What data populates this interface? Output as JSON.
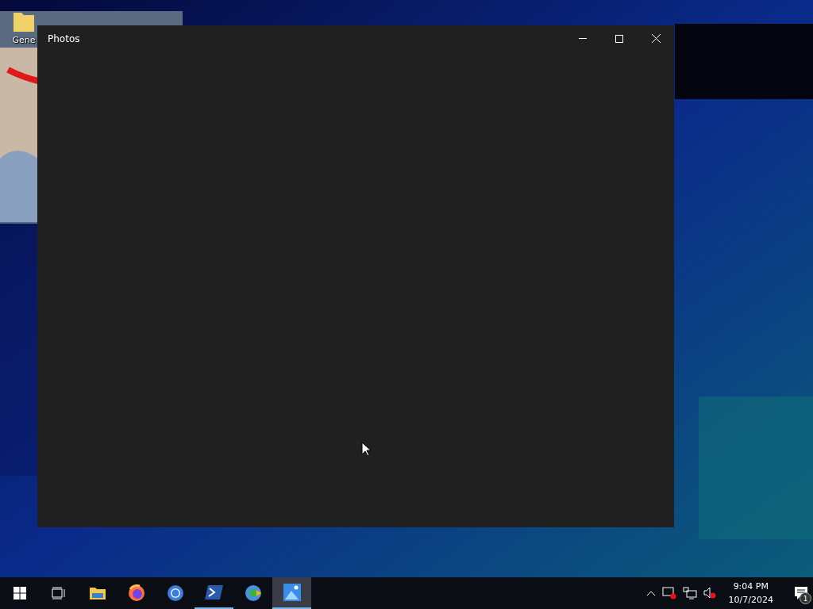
{
  "desktop": {
    "icons": [
      {
        "label": "Gene"
      }
    ]
  },
  "window": {
    "title": "Photos"
  },
  "taskbar": {
    "apps": [
      {
        "kind": "explorer",
        "open": false,
        "selected": false
      },
      {
        "kind": "firefox",
        "open": false,
        "selected": false
      },
      {
        "kind": "chrome",
        "open": false,
        "selected": false
      },
      {
        "kind": "powershell",
        "open": true,
        "selected": false
      },
      {
        "kind": "canary",
        "open": false,
        "selected": false
      },
      {
        "kind": "photos",
        "open": true,
        "selected": true
      }
    ],
    "clock": {
      "time": "9:04 PM",
      "date": "10/7/2024"
    },
    "notifications": {
      "count": "1"
    }
  }
}
